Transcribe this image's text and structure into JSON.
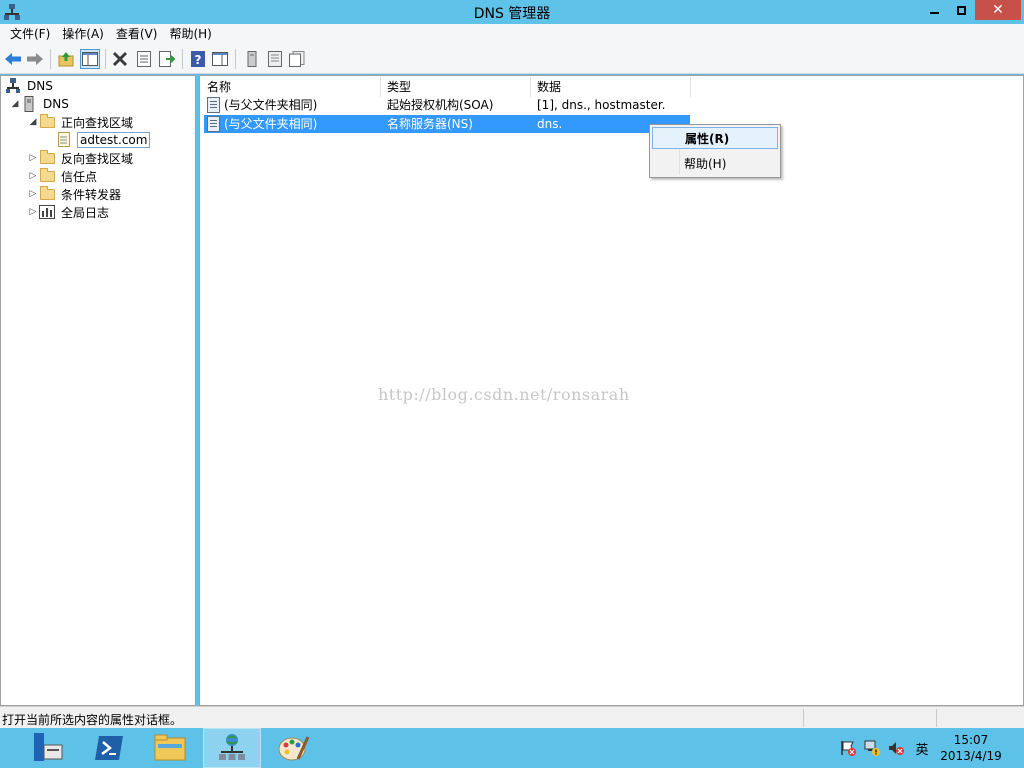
{
  "window": {
    "title": "DNS 管理器"
  },
  "menu": [
    "文件(F)",
    "操作(A)",
    "查看(V)",
    "帮助(H)"
  ],
  "tree": [
    {
      "label": "DNS",
      "level": 0,
      "expanded": true
    },
    {
      "label": "DNS",
      "level": 1,
      "expanded": true
    },
    {
      "label": "正向查找区域",
      "level": 2,
      "expanded": true
    },
    {
      "label": "adtest.com",
      "level": 3,
      "selected": true
    },
    {
      "label": "反向查找区域",
      "level": 2,
      "expanded": false
    },
    {
      "label": "信任点",
      "level": 2,
      "expanded": false
    },
    {
      "label": "条件转发器",
      "level": 2,
      "expanded": false
    },
    {
      "label": "全局日志",
      "level": 2,
      "expanded": false
    }
  ],
  "columns": [
    "名称",
    "类型",
    "数据"
  ],
  "records": [
    {
      "name": "(与父文件夹相同)",
      "type": "起始授权机构(SOA)",
      "data": "[1], dns., hostmaster."
    },
    {
      "name": "(与父文件夹相同)",
      "type": "名称服务器(NS)",
      "data": "dns.",
      "selected": true
    }
  ],
  "context_menu": [
    "属性(R)",
    "帮助(H)"
  ],
  "watermark": "http://blog.csdn.net/ronsarah",
  "status": {
    "text": "打开当前所选内容的属性对话框。"
  },
  "taskbar": {
    "tray_lang": "英",
    "time": "15:07",
    "date": "2013/4/19"
  },
  "colors": {
    "titlebar": "#5fc3e9",
    "close_button": "#c7504b",
    "selection": "#3399ff",
    "taskbar": "#5ec2e8"
  }
}
